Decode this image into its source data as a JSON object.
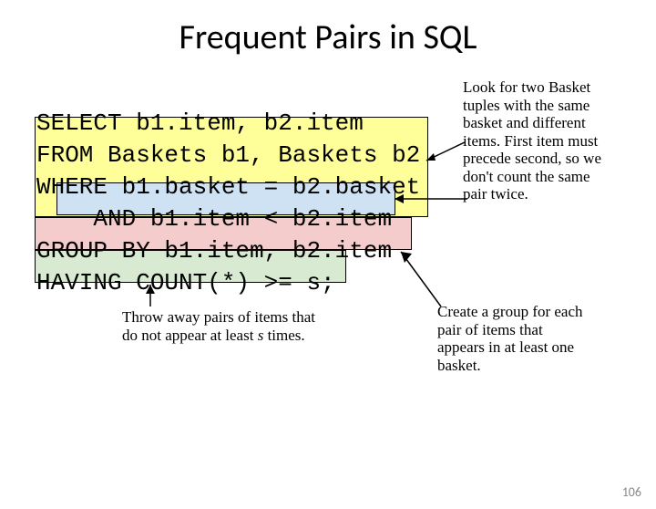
{
  "title": "Frequent Pairs in SQL",
  "sql": {
    "line1": "SELECT b1.item, b2.item",
    "line2": "FROM Baskets b1, Baskets b2",
    "line3": "WHERE b1.basket = b2.basket",
    "line4": "    AND b1.item < b2.item",
    "line5": "GROUP BY b1.item, b2.item",
    "line6": "HAVING COUNT(*) >= s;"
  },
  "notes": {
    "topright": "Look for two Basket tuples with the same basket and different items. First item must precede second, so we don't count the same pair twice.",
    "bottomright": "Create a group for each pair of items that appears in at least one basket.",
    "bottomleft_pre": "Throw away pairs of items that do not appear at least ",
    "bottomleft_var": "s",
    "bottomleft_post": "  times."
  },
  "pagenum": "106"
}
